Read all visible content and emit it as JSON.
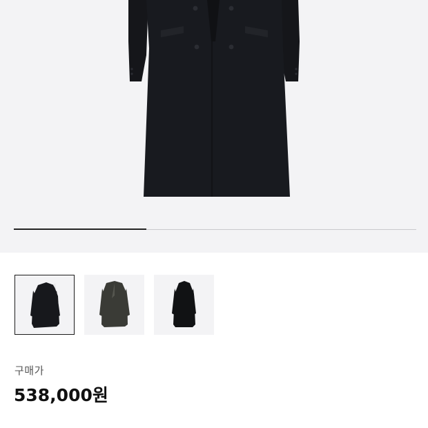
{
  "product": {
    "images_total": 3,
    "gallery_progress": 0.33,
    "thumbnails": [
      {
        "name": "black-coat",
        "color": "#17181c",
        "selected": true
      },
      {
        "name": "charcoal-coat",
        "color": "#3a3b36",
        "selected": false
      },
      {
        "name": "black-coat-alt",
        "color": "#111214",
        "selected": false
      }
    ]
  },
  "price": {
    "label": "구매가",
    "value": "538,000원"
  }
}
